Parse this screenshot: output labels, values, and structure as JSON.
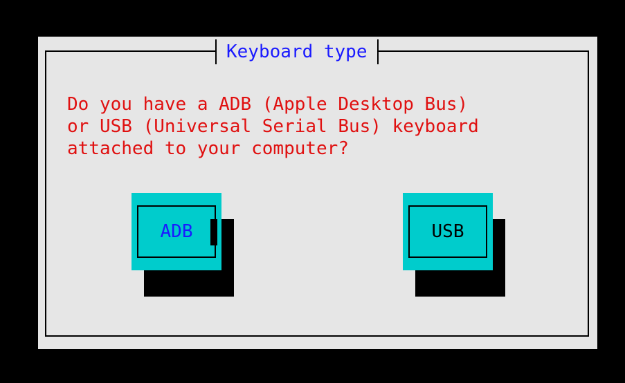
{
  "dialog": {
    "title": "Keyboard type",
    "question": "Do you have a ADB (Apple Desktop Bus)\nor USB (Universal Serial Bus) keyboard\nattached to your computer?"
  },
  "buttons": [
    {
      "label": "ADB",
      "focused": true,
      "label_color": "#1a1aff"
    },
    {
      "label": "USB",
      "focused": false,
      "label_color": "#000000"
    }
  ],
  "colors": {
    "background": "#000000",
    "dialog": "#e6e6e6",
    "title": "#1a1aff",
    "question": "#e01010",
    "button": "#00cccc"
  }
}
